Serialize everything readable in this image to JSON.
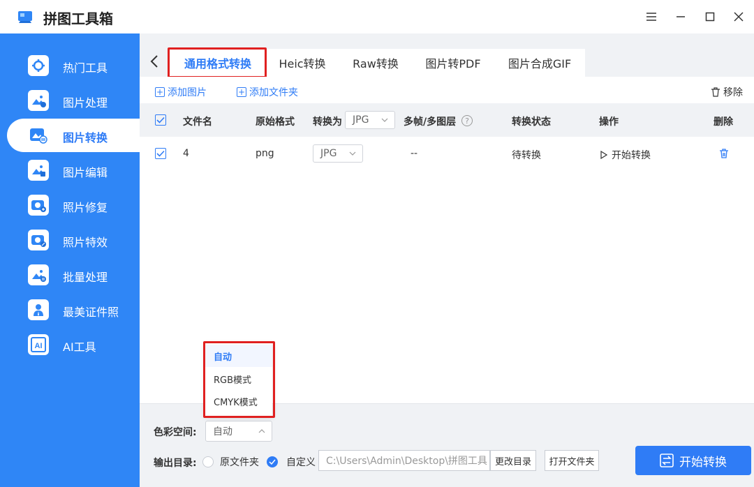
{
  "app": {
    "title": "拼图工具箱"
  },
  "sidebar": {
    "items": [
      {
        "label": "热门工具",
        "icon": "hot-tools-icon"
      },
      {
        "label": "图片处理",
        "icon": "image-process-icon"
      },
      {
        "label": "图片转换",
        "icon": "image-convert-icon",
        "active": true
      },
      {
        "label": "图片编辑",
        "icon": "image-edit-icon"
      },
      {
        "label": "照片修复",
        "icon": "photo-repair-icon"
      },
      {
        "label": "照片特效",
        "icon": "photo-effect-icon"
      },
      {
        "label": "批量处理",
        "icon": "batch-process-icon"
      },
      {
        "label": "最美证件照",
        "icon": "id-photo-icon"
      },
      {
        "label": "AI工具",
        "icon": "ai-tools-icon"
      }
    ]
  },
  "tabs": [
    {
      "label": "通用格式转换",
      "active": true
    },
    {
      "label": "Heic转换"
    },
    {
      "label": "Raw转换"
    },
    {
      "label": "图片转PDF"
    },
    {
      "label": "图片合成GIF"
    }
  ],
  "toolbar": {
    "add_image": "添加图片",
    "add_folder": "添加文件夹",
    "remove": "移除"
  },
  "table": {
    "headers": {
      "filename": "文件名",
      "original_format": "原始格式",
      "convert_to": "转换为",
      "convert_to_value": "JPG",
      "multiframe": "多帧/多图层",
      "status": "转换状态",
      "action": "操作",
      "delete": "删除"
    },
    "rows": [
      {
        "filename": "4",
        "original_format": "png",
        "target_format": "JPG",
        "multiframe": "--",
        "status": "待转换",
        "action": "开始转换"
      }
    ]
  },
  "color_space": {
    "label": "色彩空间:",
    "value": "自动",
    "options": [
      "自动",
      "RGB模式",
      "CMYK模式"
    ]
  },
  "output": {
    "label": "输出目录:",
    "option_original": "原文件夹",
    "option_custom": "自定义",
    "path": "C:\\Users\\Admin\\Desktop\\拼图工具",
    "change_dir": "更改目录",
    "open_folder": "打开文件夹"
  },
  "start_button": "开始转换",
  "colors": {
    "accent": "#2f7cf6",
    "sidebar": "#2f86f6",
    "highlight": "#e02020"
  }
}
